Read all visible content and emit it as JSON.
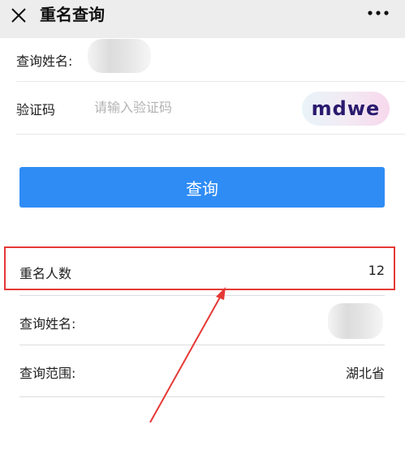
{
  "header": {
    "title": "重名查询",
    "close_icon": "close-icon",
    "more_icon": "more-dots-icon",
    "background": "#ededed"
  },
  "form": {
    "name_label": "查询姓名:",
    "captcha_label": "验证码",
    "captcha_placeholder": "请输入验证码",
    "captcha_value": "",
    "captcha_text": "mdwe"
  },
  "query_button": {
    "label": "查询",
    "color": "#2f8cf5"
  },
  "result": {
    "rows": [
      {
        "label": "重名人数",
        "value": "12"
      },
      {
        "label": "查询姓名:",
        "value": ""
      },
      {
        "label": "查询范围:",
        "value": "湖北省"
      }
    ]
  },
  "annotation": {
    "color": "#e53935"
  }
}
